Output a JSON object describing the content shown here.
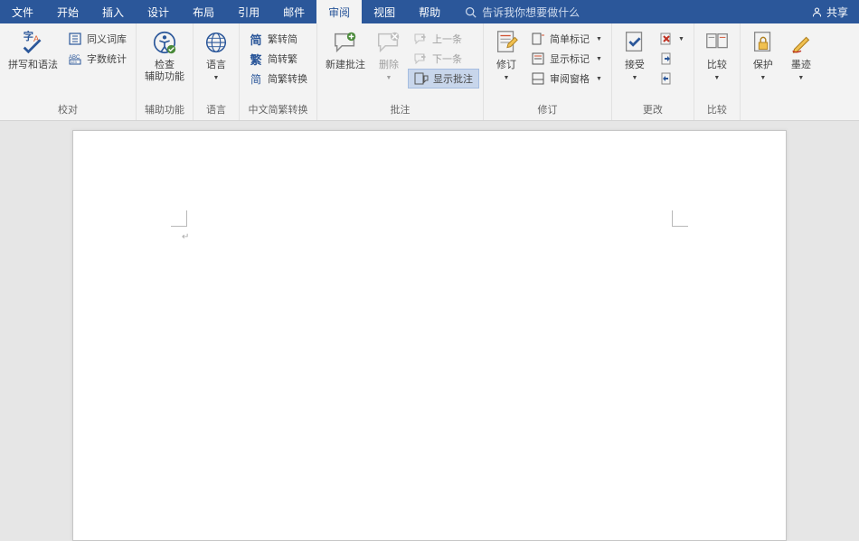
{
  "tabs": [
    "文件",
    "开始",
    "插入",
    "设计",
    "布局",
    "引用",
    "邮件",
    "审阅",
    "视图",
    "帮助"
  ],
  "active_tab_index": 7,
  "tellme": "告诉我你想要做什么",
  "share": "共享",
  "ribbon": {
    "proofing": {
      "label": "校对",
      "spelling": "拼写和语法",
      "thesaurus": "同义词库",
      "wordcount": "字数统计",
      "accessibility": "检查\n辅助功能",
      "accessibility_sub": "辅助功能"
    },
    "language": {
      "label": "语言",
      "btn": "语言"
    },
    "chinese": {
      "label": "中文简繁转换",
      "t2s": "繁转简",
      "s2t": "简转繁",
      "convert": "简繁转换"
    },
    "comments": {
      "label": "批注",
      "new": "新建批注",
      "delete": "删除",
      "prev": "上一条",
      "next": "下一条",
      "show": "显示批注"
    },
    "tracking": {
      "label": "修订",
      "track": "修订",
      "display_mode": "简单标记",
      "show_markup": "显示标记",
      "pane": "审阅窗格"
    },
    "changes": {
      "label": "更改",
      "accept": "接受"
    },
    "compare": {
      "label": "比较",
      "btn": "比较"
    },
    "protect": {
      "label": "",
      "protect": "保护",
      "ink": "墨迹"
    }
  }
}
